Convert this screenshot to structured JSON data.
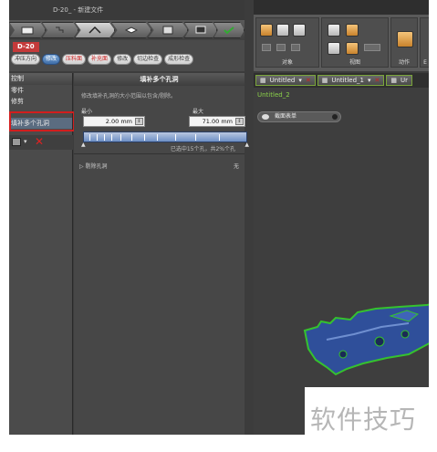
{
  "window": {
    "title": "D-20_ - 新建文件"
  },
  "document": {
    "label": "D-20"
  },
  "feature_tabs": [
    {
      "label": "冲压方向",
      "style": "normal"
    },
    {
      "label": "修改",
      "style": "selected"
    },
    {
      "label": "压料面",
      "style": "red"
    },
    {
      "label": "补充面",
      "style": "red"
    },
    {
      "label": "修改",
      "style": "normal"
    },
    {
      "label": "切边检查",
      "style": "normal"
    },
    {
      "label": "成形检查",
      "style": "normal"
    }
  ],
  "ribbon": {
    "groups": [
      "对象",
      "视图",
      "动作",
      "E"
    ]
  },
  "left_panel": {
    "header": "控制",
    "items": [
      "零件",
      "修剪",
      "填补多个孔洞"
    ],
    "selected_index": 2
  },
  "fill_holes": {
    "title": "填补多个孔洞",
    "description": "修改填补孔洞的大小范围以包含/剔除。",
    "min_label": "最小",
    "max_label": "最大",
    "min_value": "2.00 mm",
    "max_value": "71.00 mm",
    "status": "已选中15个孔，共2%个孔",
    "exclude_label": "剔除孔洞",
    "exclude_value": "无"
  },
  "viewport": {
    "tabs": [
      "Untitled",
      "Untitled_1",
      "Ur"
    ],
    "document_name": "Untitled_2",
    "layer_label": "截面表单"
  },
  "watermark": "软件技巧",
  "colors": {
    "highlight": "#d21e1e",
    "accent_green": "#8bd14a",
    "model_blue": "#2f4f9a"
  }
}
